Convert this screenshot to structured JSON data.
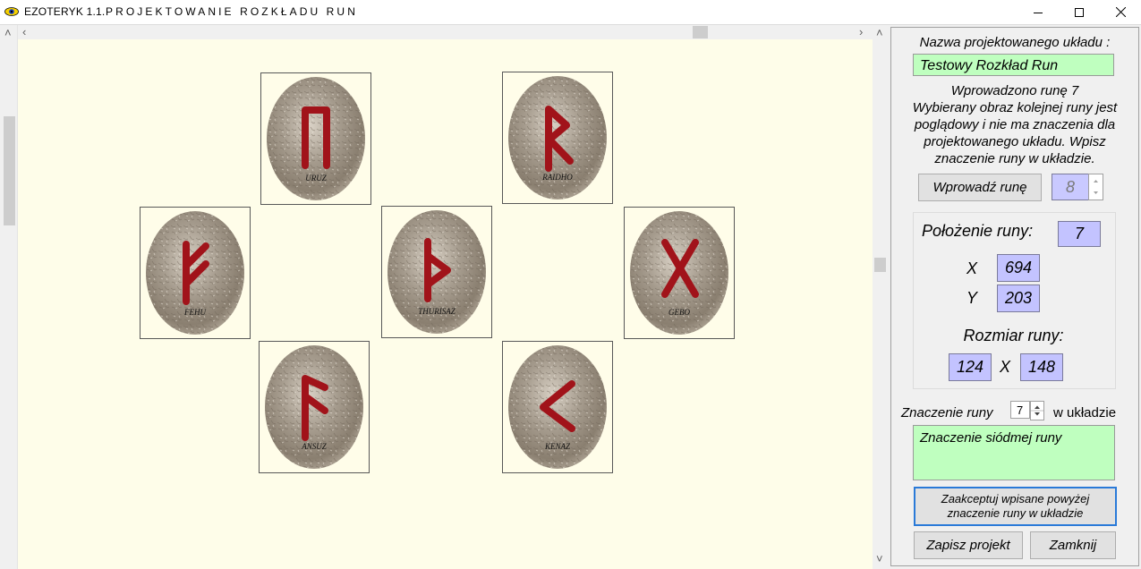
{
  "window": {
    "app_name": "EZOTERYK 1.1.",
    "subtitle": "PROJEKTOWANIE ROZKŁADU RUN"
  },
  "colors": {
    "canvas_bg": "#fefde9",
    "rune_red": "#a1131a",
    "field_green": "#bfffbf",
    "field_blue": "#c3c3ff"
  },
  "runes": [
    {
      "name": "URUZ",
      "glyph": "uruz"
    },
    {
      "name": "RAIDHO",
      "glyph": "raidho"
    },
    {
      "name": "FEHU",
      "glyph": "fehu"
    },
    {
      "name": "THURISAZ",
      "glyph": "thurisaz"
    },
    {
      "name": "GEBO",
      "glyph": "gebo"
    },
    {
      "name": "ANSUZ",
      "glyph": "ansuz"
    },
    {
      "name": "KENAZ",
      "glyph": "kenaz"
    }
  ],
  "panel": {
    "layout_name_label": "Nazwa projektowanego układu :",
    "layout_name_value": "Testowy Rozkład Run",
    "info_line1": "Wprowadzono runę 7",
    "info_text": "Wybierany obraz kolejnej runy jest poglądowy i nie ma znaczenia dla projektowanego układu. Wpisz znaczenie runy w układzie.",
    "enter_rune_button": "Wprowadź runę",
    "rune_counter": "8",
    "position_label": "Położenie runy:",
    "position_value": "7",
    "x_label": "X",
    "x_value": "694",
    "y_label": "Y",
    "y_value": "203",
    "size_label": "Rozmiar runy:",
    "size_w": "124",
    "size_sep": "X",
    "size_h": "148",
    "meaning_label": "Znaczenie runy",
    "meaning_index": "7",
    "meaning_suffix": "w układzie",
    "meaning_text": "Znaczenie siódmej runy",
    "accept_button": "Zaakceptuj wpisane powyżej znaczenie runy w układzie",
    "save_button": "Zapisz projekt",
    "close_button": "Zamknij"
  }
}
